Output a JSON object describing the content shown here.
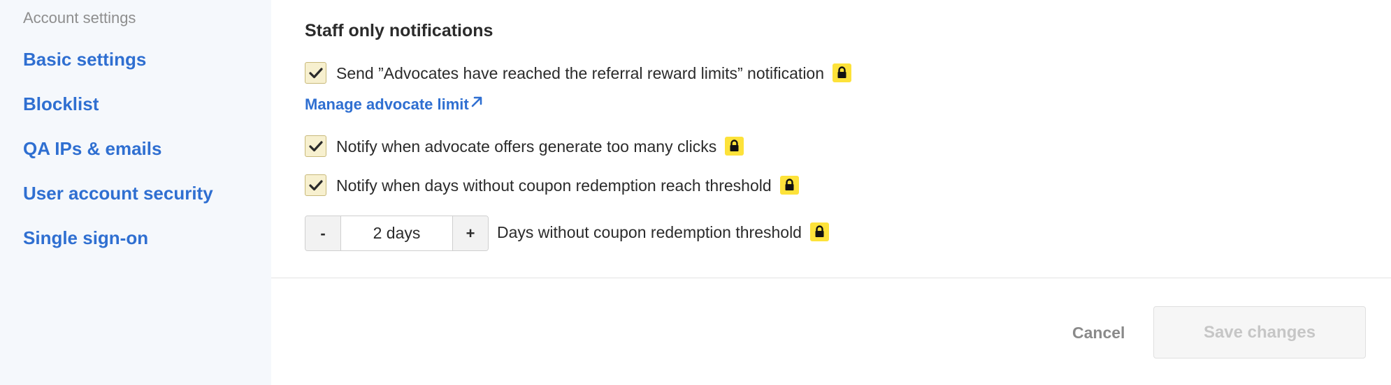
{
  "sidebar": {
    "heading": "Account settings",
    "items": [
      {
        "label": "Basic settings"
      },
      {
        "label": "Blocklist"
      },
      {
        "label": "QA IPs & emails"
      },
      {
        "label": "User account security"
      },
      {
        "label": "Single sign-on"
      }
    ]
  },
  "main": {
    "section_title": "Staff only notifications",
    "options": [
      {
        "label": "Send ”Advocates have reached the referral reward limits” notification",
        "checked": true,
        "locked": true
      },
      {
        "label": "Notify when advocate offers generate too many clicks",
        "checked": true,
        "locked": true
      },
      {
        "label": "Notify when days without coupon redemption reach threshold",
        "checked": true,
        "locked": true
      }
    ],
    "manage_link": "Manage advocate limit",
    "stepper": {
      "minus": "-",
      "plus": "+",
      "value": "2 days",
      "label": "Days without coupon redemption threshold"
    }
  },
  "footer": {
    "cancel_label": "Cancel",
    "save_label": "Save changes"
  },
  "colors": {
    "accent": "#2f6fd1",
    "sidebar_bg": "#f5f8fc",
    "lock_badge": "#fde23a",
    "checkbox_bg": "#f7f0cf"
  },
  "icons": {
    "check": "check-icon",
    "lock": "lock-icon",
    "external": "external-link-icon"
  }
}
